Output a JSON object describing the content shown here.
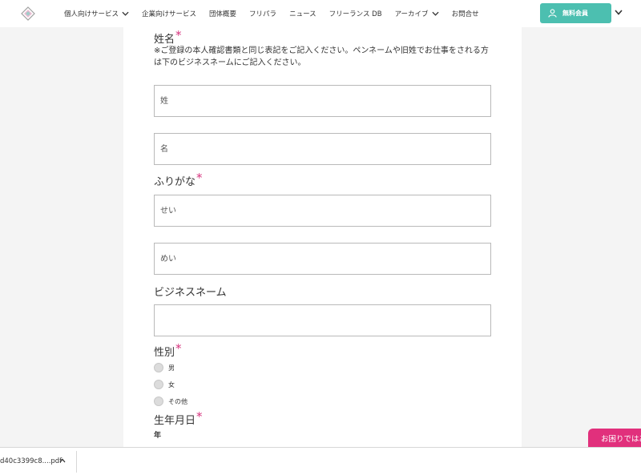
{
  "header": {
    "nav": [
      {
        "label": "個人向けサービス",
        "has_dropdown": true
      },
      {
        "label": "企業向けサービス",
        "has_dropdown": false
      },
      {
        "label": "団体概要",
        "has_dropdown": false
      },
      {
        "label": "フリパラ",
        "has_dropdown": false
      },
      {
        "label": "ニュース",
        "has_dropdown": false
      },
      {
        "label": "フリーランス DB",
        "has_dropdown": false
      },
      {
        "label": "アーカイブ",
        "has_dropdown": true
      },
      {
        "label": "お問合せ",
        "has_dropdown": false
      }
    ],
    "member_button": "無料会員",
    "accent_color": "#4cbfb0"
  },
  "form": {
    "name_label": "姓名",
    "required_mark": "*",
    "name_note": "※ご登録の本人確認書類と同じ表記をご記入ください。ペンネームや旧姓でお仕事をされる方は下のビジネスネームにご記入ください。",
    "last_name_placeholder": "姓",
    "first_name_placeholder": "名",
    "kana_label": "ふりがな",
    "last_kana_placeholder": "せい",
    "first_kana_placeholder": "めい",
    "business_name_label": "ビジネスネーム",
    "business_name_placeholder": "",
    "gender_label": "性別",
    "gender_options": [
      "男",
      "女",
      "その他"
    ],
    "birthdate_label": "生年月日",
    "year_label": "年"
  },
  "help_tab": "お困りではありませんか",
  "download_bar": {
    "file_name": "d40c3399c8....pdf"
  },
  "colors": {
    "required": "#d6337e",
    "help_tab": "#e1307c"
  }
}
